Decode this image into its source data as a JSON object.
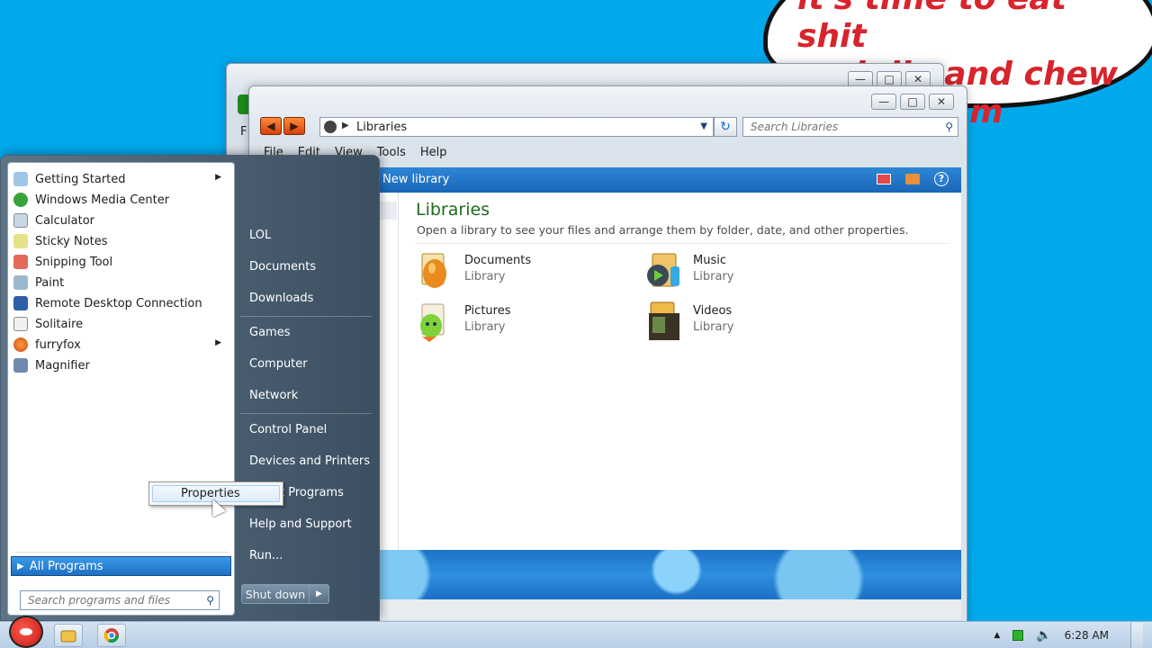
{
  "wallpaper_text": "it's time to eat shit\nand die and chew\nbubblegum",
  "explorer": {
    "address": "Libraries",
    "search_placeholder": "Search Libraries",
    "menu": [
      "File",
      "Edit",
      "View",
      "Tools",
      "Help"
    ],
    "new_library_label": "New library",
    "title": "Libraries",
    "description": "Open a library to see your files and arrange them by folder, date, and other properties.",
    "libraries": [
      {
        "name": "Documents",
        "sub": "Library"
      },
      {
        "name": "Music",
        "sub": "Library"
      },
      {
        "name": "Pictures",
        "sub": "Library"
      },
      {
        "name": "Videos",
        "sub": "Library"
      }
    ],
    "back_menu_f": "F"
  },
  "start_menu": {
    "programs": [
      {
        "label": "Getting Started",
        "icon": "getting-started-icon",
        "submenu": true
      },
      {
        "label": "Windows Media Center",
        "icon": "media-center-icon",
        "submenu": false
      },
      {
        "label": "Calculator",
        "icon": "calculator-icon",
        "submenu": false
      },
      {
        "label": "Sticky Notes",
        "icon": "sticky-notes-icon",
        "submenu": false
      },
      {
        "label": "Snipping Tool",
        "icon": "snipping-tool-icon",
        "submenu": false
      },
      {
        "label": "Paint",
        "icon": "paint-icon",
        "submenu": false
      },
      {
        "label": "Remote Desktop Connection",
        "icon": "remote-desktop-icon",
        "submenu": false
      },
      {
        "label": "Solitaire",
        "icon": "solitaire-icon",
        "submenu": false
      },
      {
        "label": "furryfox",
        "icon": "furryfox-icon",
        "submenu": true
      },
      {
        "label": "Magnifier",
        "icon": "magnifier-icon",
        "submenu": false
      }
    ],
    "all_programs": "All Programs",
    "search_placeholder": "Search programs and files",
    "right_links": [
      "LOL",
      "Documents",
      "Downloads",
      "Games",
      "Computer",
      "Network",
      "Control Panel",
      "Devices and Printers",
      "Default Programs",
      "Help and Support",
      "Run..."
    ],
    "right_links_visible": [
      "LOL",
      "Documents",
      "Downloads",
      "Games",
      "Computer",
      "Network",
      "Control Panel",
      "Devices and Printers",
      "t Programs",
      "Help and Support",
      "Run..."
    ],
    "shutdown": "Shut down"
  },
  "context_menu": {
    "item": "Properties"
  },
  "taskbar": {
    "clock": "6:28 AM"
  },
  "colors": {
    "desktop": "#00a8ec",
    "bubble_text": "#d8242c",
    "library_title": "#1e6a1e"
  }
}
